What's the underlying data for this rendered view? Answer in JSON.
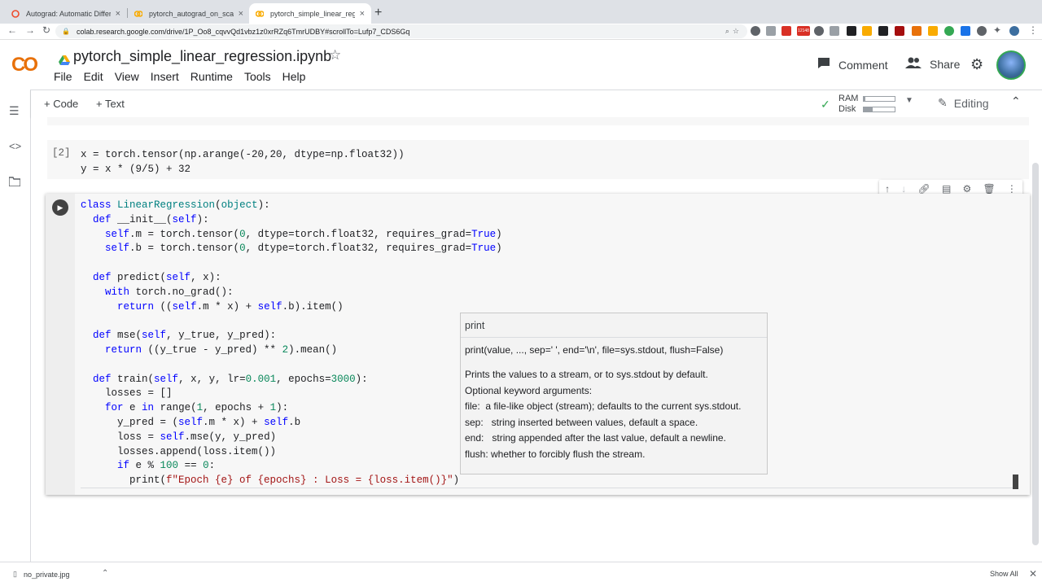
{
  "browser": {
    "tabs": [
      {
        "title": "Autograd: Automatic Differentiati",
        "close": "×"
      },
      {
        "title": "pytorch_autograd_on_scalars.ip",
        "close": "×"
      },
      {
        "title": "pytorch_simple_linear_regressio",
        "close": "×"
      }
    ],
    "new_tab": "+",
    "url": "colab.research.google.com/drive/1P_Oo8_cqvvQd1vbz1z0xrRZq6TmrUDBY#scrollTo=Lufp7_CDS6Gq",
    "ext_badge": "12148"
  },
  "colab": {
    "logo": "CO",
    "notebook_title": "pytorch_simple_linear_regression.ipynb",
    "menu": [
      "File",
      "Edit",
      "View",
      "Insert",
      "Runtime",
      "Tools",
      "Help"
    ],
    "comment_label": "Comment",
    "share_label": "Share"
  },
  "toolbar": {
    "code_label": "+ Code",
    "text_label": "+ Text",
    "ram_label": "RAM",
    "disk_label": "Disk",
    "ram_fill": 0.05,
    "disk_fill": 0.3,
    "editing_label": "Editing"
  },
  "cells": {
    "cell2": {
      "number": "[2]",
      "line1": "x = torch.tensor(np.arange(-20,20, dtype=np.float32))",
      "line2": "y = x * (9/5) + 32"
    }
  },
  "tooltip": {
    "name": "print",
    "signature": "print(value, ..., sep=' ', end='\\n', file=sys.stdout, flush=False)",
    "lines": [
      "Prints the values to a stream, or to sys.stdout by default.",
      "Optional keyword arguments:",
      "file:  a file-like object (stream); defaults to the current sys.stdout.",
      "sep:   string inserted between values, default a space.",
      "end:   string appended after the last value, default a newline.",
      "flush: whether to forcibly flush the stream."
    ]
  },
  "downloads": {
    "file": "no_private.jpg",
    "show_all": "Show All"
  },
  "colors": {
    "colab_orange": "#f9ab00",
    "check_green": "#34a853",
    "keyword_blue": "#0000ff"
  }
}
